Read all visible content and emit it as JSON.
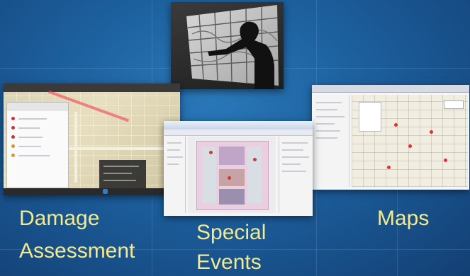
{
  "captions": {
    "damage_line1": "Damage",
    "damage_line2": "Assessment",
    "special_line1": "Special",
    "special_line2": "Events",
    "maps": "Maps"
  },
  "colors": {
    "background": "#1c5e9c",
    "caption": "#f2ea8c"
  },
  "images": [
    {
      "name": "touch-wall-silhouette",
      "description_icon": "person-at-map-wall-icon"
    },
    {
      "name": "damage-assessment-app-screenshot",
      "description_icon": "tablet-map-app-icon"
    },
    {
      "name": "special-events-app-screenshot",
      "description_icon": "event-map-app-icon"
    },
    {
      "name": "maps-app-screenshot",
      "description_icon": "desktop-map-app-icon"
    }
  ]
}
